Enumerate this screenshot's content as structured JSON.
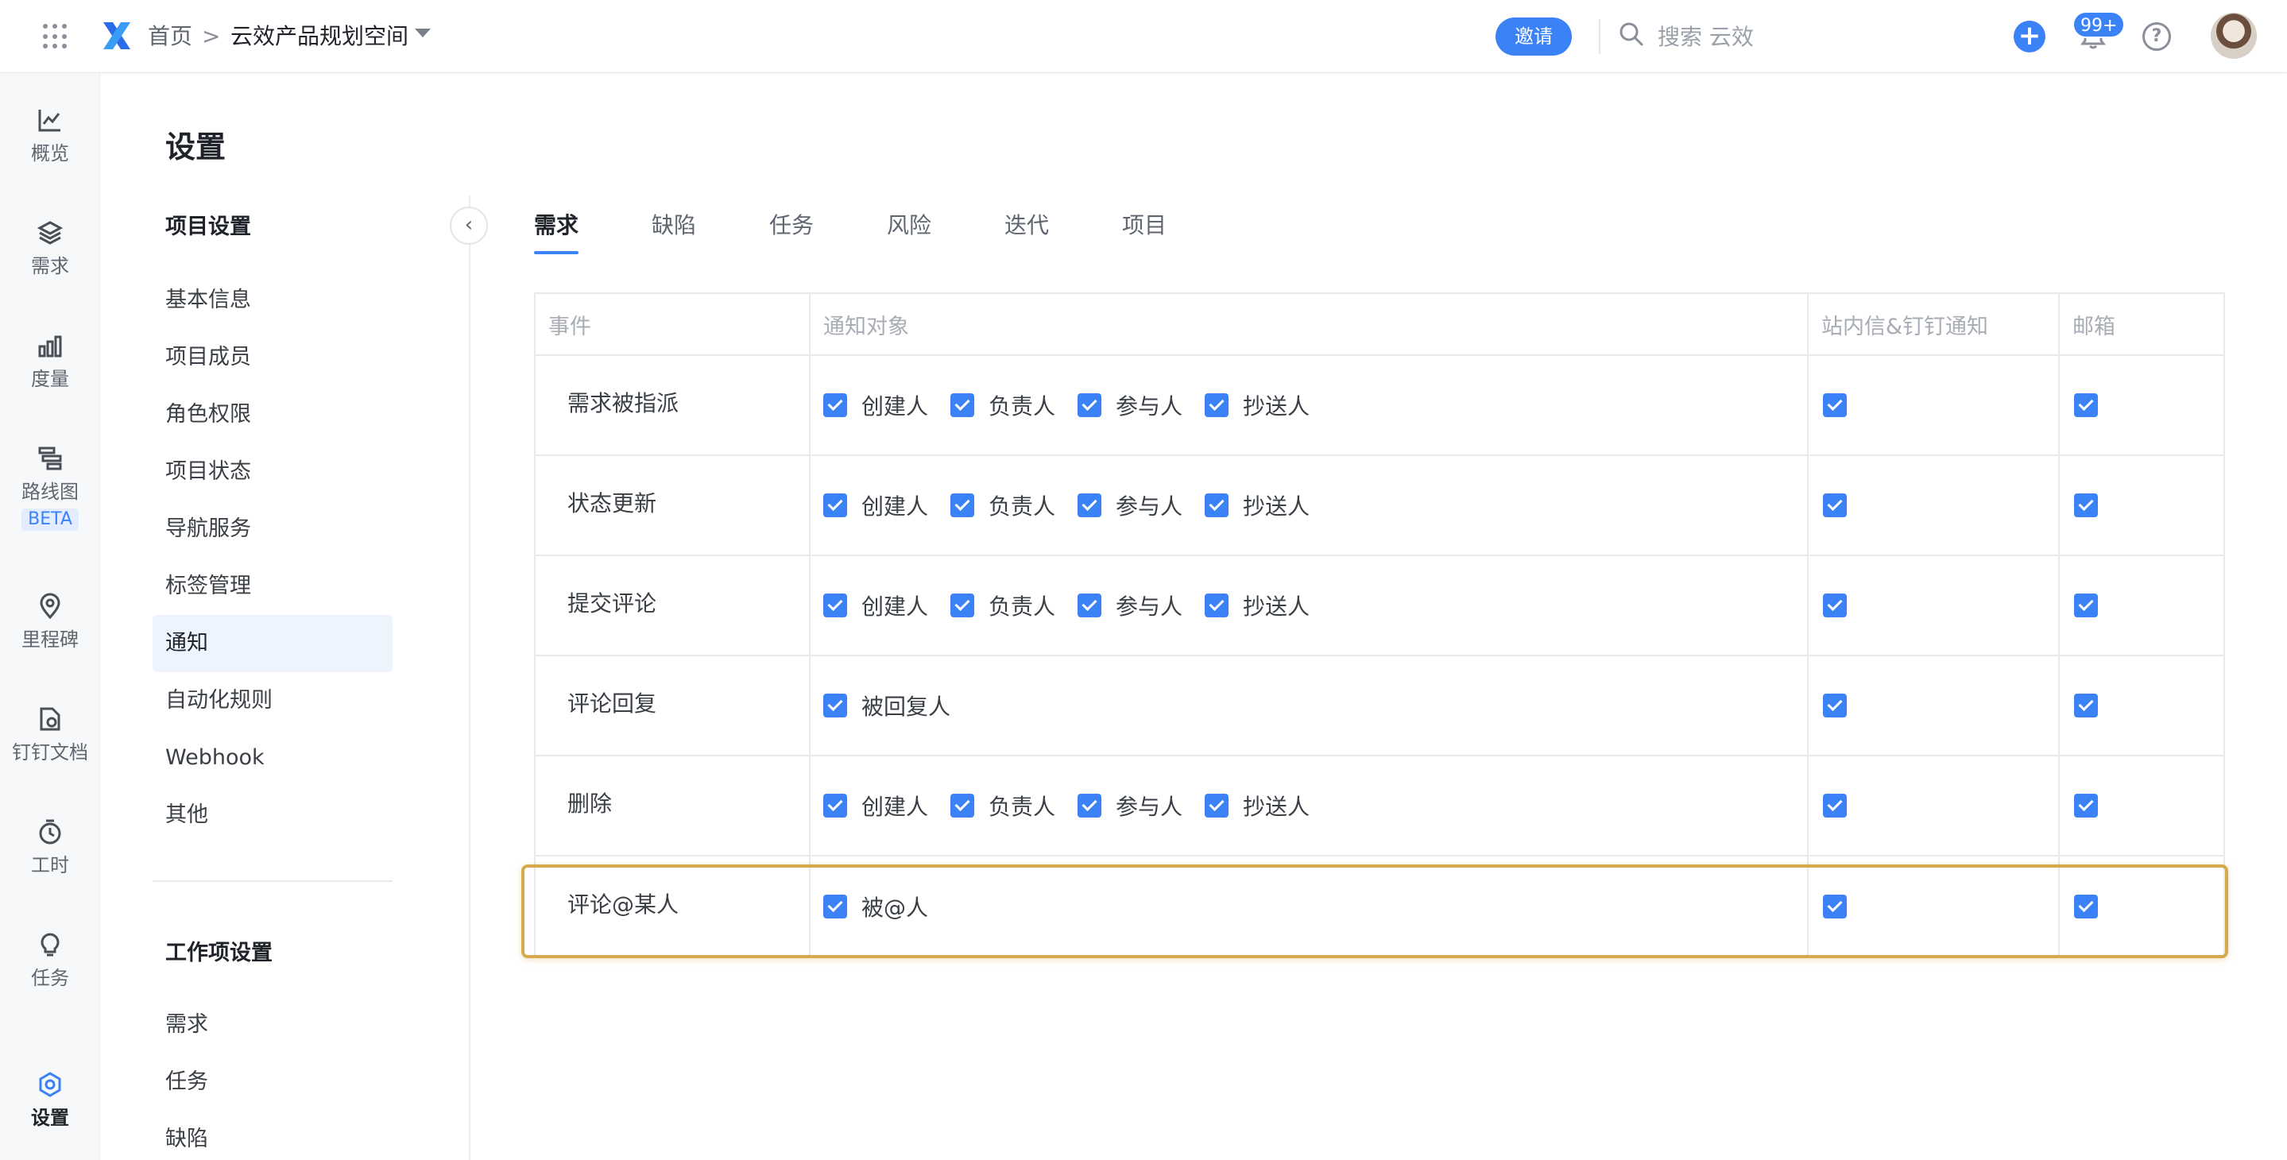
{
  "header": {
    "breadcrumb_home": "首页",
    "breadcrumb_sep": ">",
    "space_name": "云效产品规划空间",
    "invite_label": "邀请",
    "search_placeholder": "搜索 云效",
    "notification_count": "99+",
    "help_label": "?",
    "add_label": "+"
  },
  "rail": {
    "items": [
      {
        "label": "概览",
        "icon": "chart-line-icon"
      },
      {
        "label": "需求",
        "icon": "layers-icon"
      },
      {
        "label": "度量",
        "icon": "bar-chart-icon"
      },
      {
        "label": "路线图",
        "icon": "roadmap-icon",
        "badge": "BETA"
      },
      {
        "label": "里程碑",
        "icon": "location-pin-icon"
      },
      {
        "label": "钉钉文档",
        "icon": "document-icon"
      },
      {
        "label": "工时",
        "icon": "timer-icon"
      },
      {
        "label": "任务",
        "icon": "lightbulb-icon"
      },
      {
        "label": "设置",
        "icon": "settings-icon",
        "active": true
      }
    ]
  },
  "settings": {
    "title": "设置",
    "project_heading": "项目设置",
    "project_items": [
      "基本信息",
      "项目成员",
      "角色权限",
      "项目状态",
      "导航服务",
      "标签管理",
      "通知",
      "自动化规则",
      "Webhook",
      "其他"
    ],
    "active_item": "通知",
    "workitem_heading": "工作项设置",
    "workitem_items": [
      "需求",
      "任务",
      "缺陷"
    ],
    "collapse_label": "‹"
  },
  "tabs": [
    "需求",
    "缺陷",
    "任务",
    "风险",
    "迭代",
    "项目"
  ],
  "active_tab": "需求",
  "table": {
    "headers": [
      "事件",
      "通知对象",
      "站内信&钉钉通知",
      "邮箱"
    ],
    "rows": [
      {
        "event": "需求被指派",
        "targets": [
          "创建人",
          "负责人",
          "参与人",
          "抄送人"
        ],
        "inbox": true,
        "email": true
      },
      {
        "event": "状态更新",
        "targets": [
          "创建人",
          "负责人",
          "参与人",
          "抄送人"
        ],
        "inbox": true,
        "email": true
      },
      {
        "event": "提交评论",
        "targets": [
          "创建人",
          "负责人",
          "参与人",
          "抄送人"
        ],
        "inbox": true,
        "email": true
      },
      {
        "event": "评论回复",
        "targets": [
          "被回复人"
        ],
        "inbox": true,
        "email": true
      },
      {
        "event": "删除",
        "targets": [
          "创建人",
          "负责人",
          "参与人",
          "抄送人"
        ],
        "inbox": true,
        "email": true
      },
      {
        "event": "评论@某人",
        "targets": [
          "被@人"
        ],
        "inbox": true,
        "email": true,
        "highlighted": true
      }
    ]
  },
  "colors": {
    "accent": "#3b82f6",
    "highlight_border": "#d6a94c",
    "active_nav_bg": "#eef4fd"
  }
}
